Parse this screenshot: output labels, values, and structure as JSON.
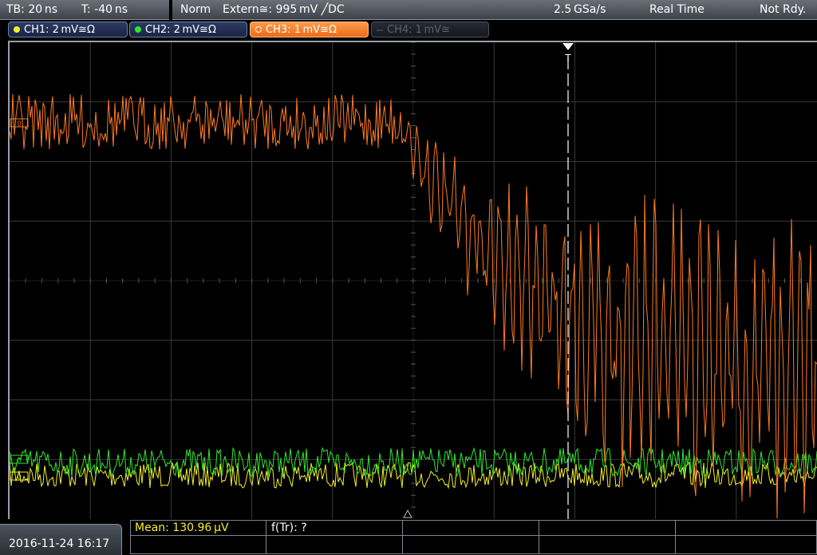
{
  "status": {
    "timebase": "TB: 20 ns",
    "trigger_offset": "T: -40 ns",
    "mode": "Norm",
    "trigger_source": "Extern≅: 995 mV ╱DC",
    "sample_rate": "2.5 GSa/s",
    "acquisition": "Real Time",
    "state": "Not Rdy."
  },
  "channels": [
    {
      "label": "CH1: 2 mV≅Ω",
      "color": "#f4ee2a",
      "active": true
    },
    {
      "label": "CH2: 2 mV≅Ω",
      "color": "#2ee82e",
      "active": true
    },
    {
      "label": "CH3: 1 mV≅Ω",
      "color": "#ff7b22",
      "active": true,
      "selected": true
    },
    {
      "label": "CH4: 1 mV≅",
      "color": "#5c6068",
      "active": false
    }
  ],
  "trigger_marker": {
    "label": "T"
  },
  "ground_markers": {
    "ch3": "0",
    "ch2": "0",
    "ch1": "0"
  },
  "datetime": "2016-11-24 16:17",
  "measurements": {
    "mean": "Mean: 130.96 µV",
    "rise_time_freq": "f(Tr): ?"
  },
  "colors": {
    "ch1": "#f4ee2a",
    "ch2": "#2ee82e",
    "ch3": "#ff7b22",
    "grid": "#3a3a3a",
    "meas_text": "#f4ee2a"
  },
  "icons": {
    "trigger_position": "down-triangle-icon",
    "trigger_level": "up-triangle-icon"
  }
}
